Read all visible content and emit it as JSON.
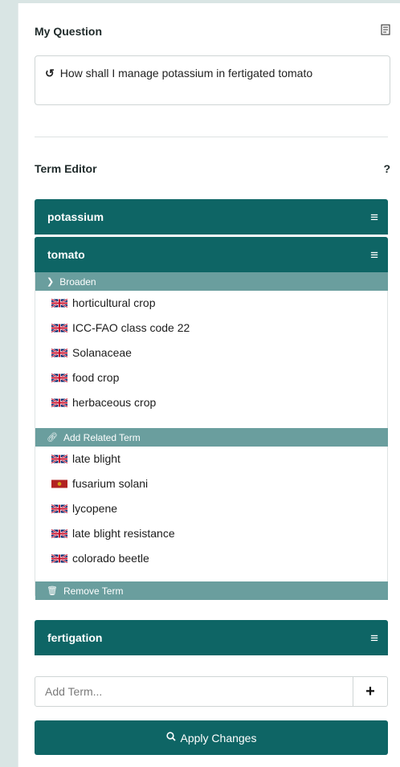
{
  "my_question": {
    "title": "My Question",
    "icon": "document-icon",
    "history_icon": "history-icon",
    "text": "How shall I manage potassium in fertigated tomato"
  },
  "term_editor": {
    "title": "Term Editor",
    "help": "?",
    "terms": [
      {
        "label": "potassium",
        "menu_icon": "hamburger-icon"
      },
      {
        "label": "tomato",
        "menu_icon": "hamburger-icon"
      },
      {
        "label": "fertigation",
        "menu_icon": "hamburger-icon"
      }
    ],
    "expanded": {
      "broaden_label": "Broaden",
      "broader_terms": [
        "horticultural crop",
        "ICC-FAO class code 22",
        "Solanaceae",
        "food crop",
        "herbaceous crop"
      ],
      "add_related_label": "Add Related Term",
      "related_terms": [
        "late blight",
        "fusarium solani",
        "lycopene",
        "late blight resistance",
        "colorado beetle"
      ],
      "remove_label": "Remove Term"
    }
  },
  "add_term": {
    "placeholder": "Add Term...",
    "plus": "+"
  },
  "apply": {
    "label": "Apply Changes",
    "icon": "search-icon"
  },
  "colors": {
    "accent": "#0e6565",
    "subheader": "#6a9e9e",
    "background": "#d9e5e4"
  }
}
